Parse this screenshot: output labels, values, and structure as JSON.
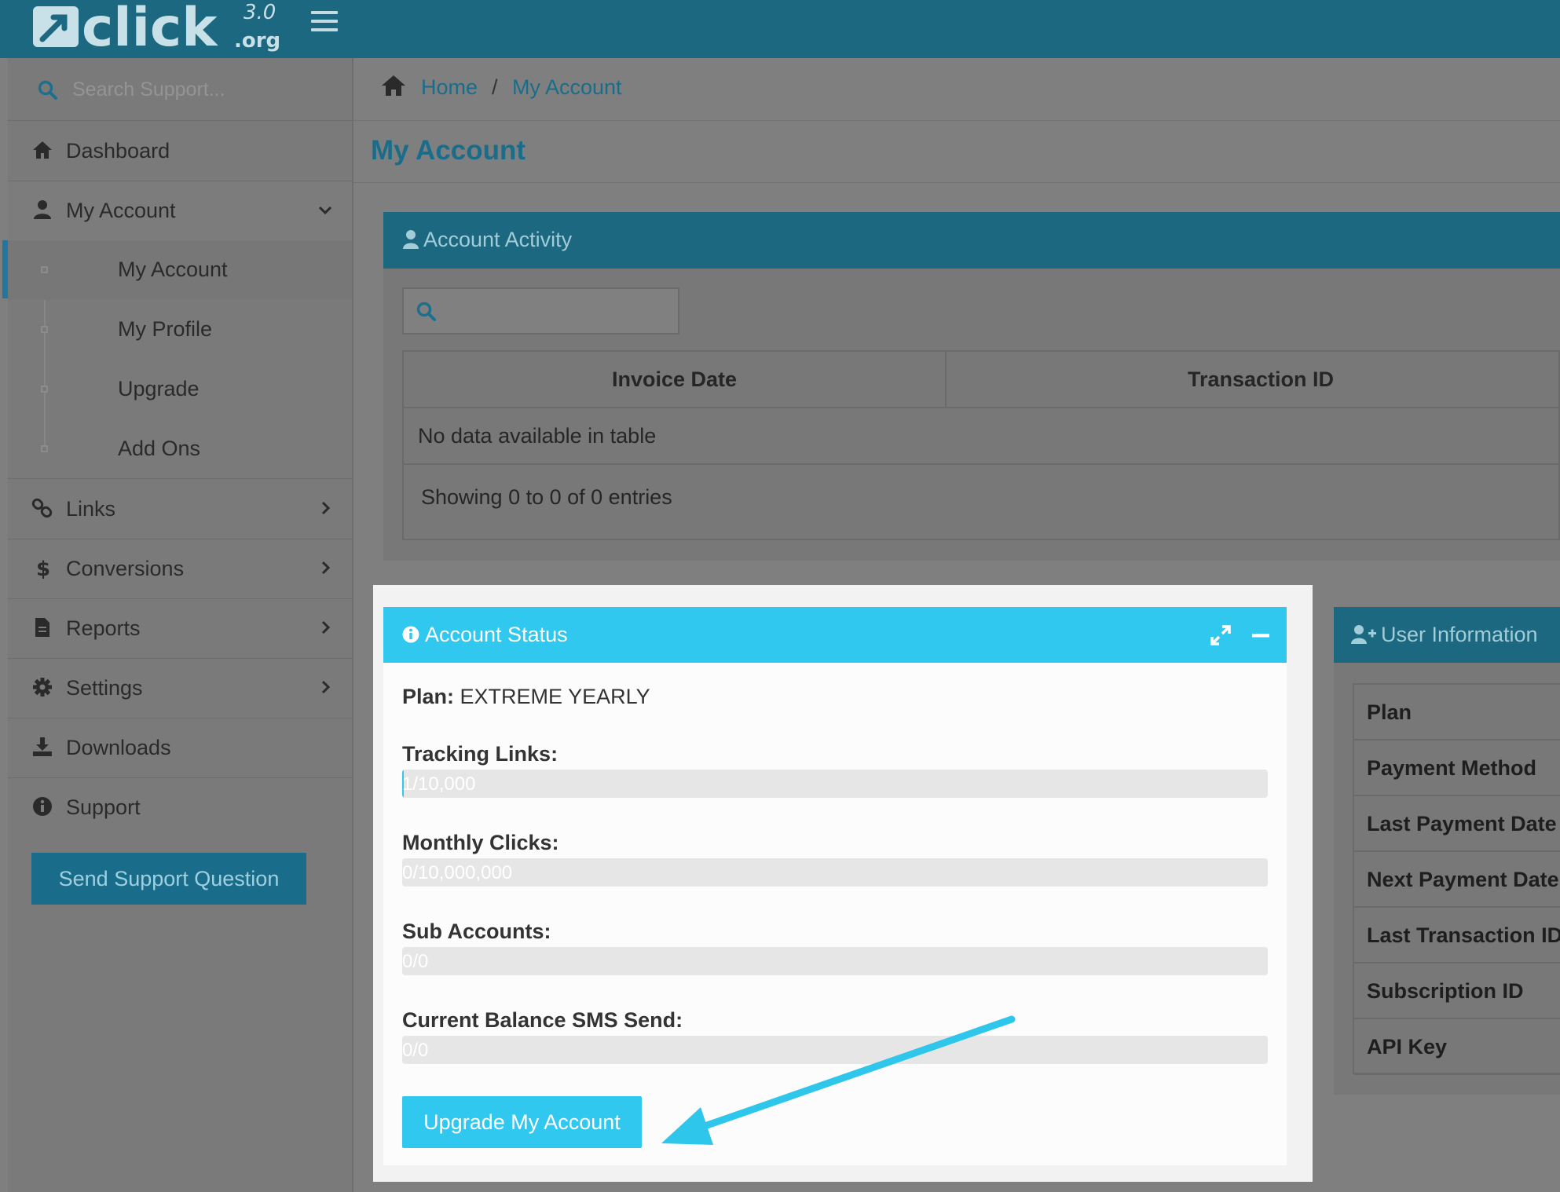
{
  "brand": {
    "logo_text": "click",
    "logo_sup": "3.0",
    "logo_sub": ".org",
    "bar_color": "#1c6880"
  },
  "sidebar": {
    "search_placeholder": "Search Support...",
    "items": [
      {
        "label": "Dashboard",
        "icon": "home-icon"
      },
      {
        "label": "My Account",
        "icon": "user-icon",
        "expanded": true
      },
      {
        "label": "Links",
        "icon": "link-icon"
      },
      {
        "label": "Conversions",
        "icon": "dollar-icon"
      },
      {
        "label": "Reports",
        "icon": "file-icon"
      },
      {
        "label": "Settings",
        "icon": "gear-icon"
      },
      {
        "label": "Downloads",
        "icon": "download-icon"
      },
      {
        "label": "Support",
        "icon": "info-icon"
      }
    ],
    "sub_items": [
      {
        "label": "My Account",
        "active": true
      },
      {
        "label": "My Profile"
      },
      {
        "label": "Upgrade"
      },
      {
        "label": "Add Ons"
      }
    ],
    "support_button": "Send Support Question"
  },
  "breadcrumb": {
    "home": "Home",
    "separator": "/",
    "current": "My Account"
  },
  "page_title": "My Account",
  "activity": {
    "title": "Account Activity",
    "columns": [
      "Invoice Date",
      "Transaction ID"
    ],
    "empty_text": "No data available in table",
    "info_text": "Showing 0 to 0 of 0 entries"
  },
  "status": {
    "title": "Account Status",
    "plan_label": "Plan:",
    "plan_value": "EXTREME YEARLY",
    "metrics": [
      {
        "label": "Tracking Links:",
        "value": "1/10,000",
        "fraction": 0.0001
      },
      {
        "label": "Monthly Clicks:",
        "value": "0/10,000,000",
        "fraction": 0
      },
      {
        "label": "Sub Accounts:",
        "value": "0/0",
        "fraction": 0
      },
      {
        "label": "Current Balance SMS Send:",
        "value": "0/0",
        "fraction": 0
      }
    ],
    "upgrade_button": "Upgrade My Account",
    "accent": "#30c8ee"
  },
  "user_info": {
    "title": "User Information",
    "rows": [
      "Plan",
      "Payment Method",
      "Last Payment Date",
      "Next Payment Date",
      "Last Transaction ID",
      "Subscription ID",
      "API Key"
    ]
  }
}
